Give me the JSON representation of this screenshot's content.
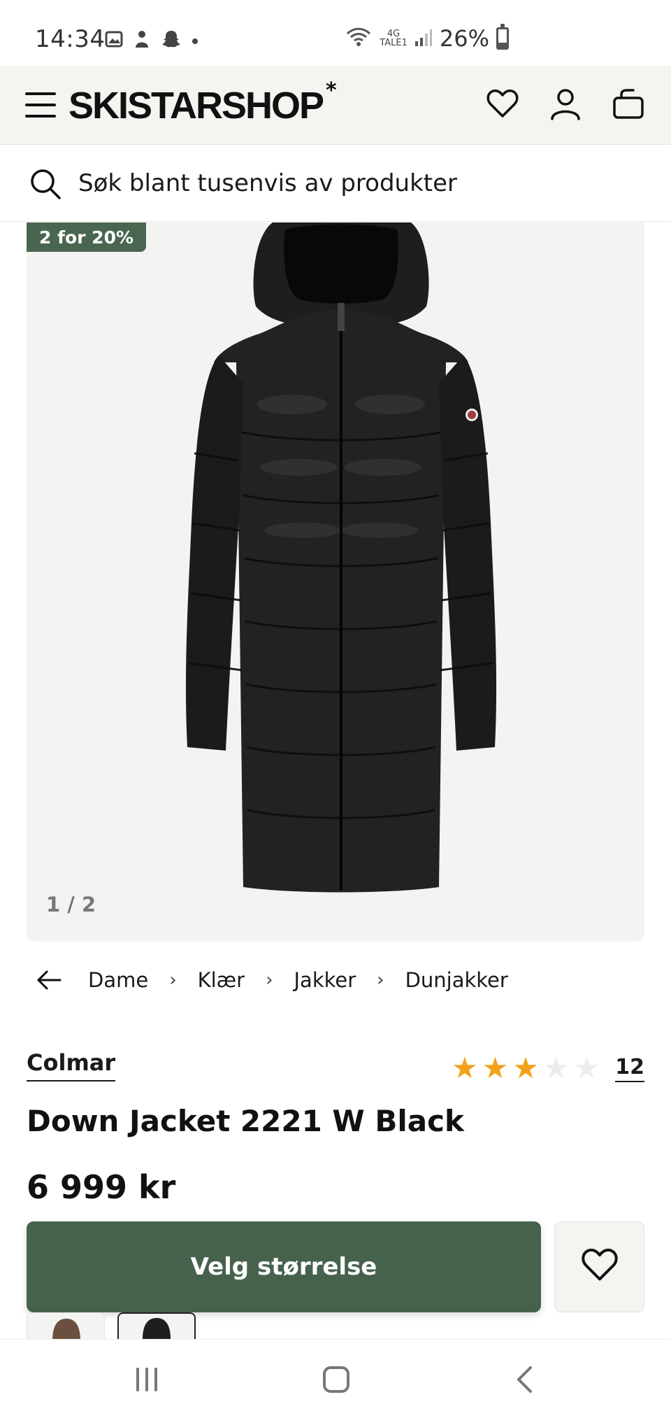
{
  "status_bar": {
    "time": "14:34",
    "battery_text": "26%",
    "battery_level": 0.26,
    "network_top": "4G",
    "network_bottom": "TALE1",
    "icons": [
      "gallery-icon",
      "app-notification-icon",
      "snapchat-icon",
      "dot-icon",
      "wifi-icon",
      "signal-icon",
      "battery-icon"
    ]
  },
  "header": {
    "logo_text": "SKISTARSHOP",
    "logo_mark": "*",
    "icons": [
      "menu-icon",
      "heart-icon",
      "account-icon",
      "cart-icon"
    ]
  },
  "search": {
    "placeholder": "Søk blant tusenvis av produkter"
  },
  "product_image": {
    "badge": "2 for 20%",
    "counter": "1 / 2"
  },
  "breadcrumb": {
    "items": [
      "Dame",
      "Klær",
      "Jakker",
      "Dunjakker"
    ]
  },
  "product": {
    "brand": "Colmar",
    "title": "Down Jacket 2221 W Black",
    "price": "6 999 kr",
    "rating": 3,
    "rating_max": 5,
    "review_count": "12"
  },
  "actions": {
    "select_size_label": "Velg størrelse"
  },
  "colors": {
    "primary_green": "#46624d",
    "badge_green": "#4a6650",
    "star_on": "#f2a21b",
    "star_off": "#ececec",
    "header_bg": "#f4f4f1"
  }
}
